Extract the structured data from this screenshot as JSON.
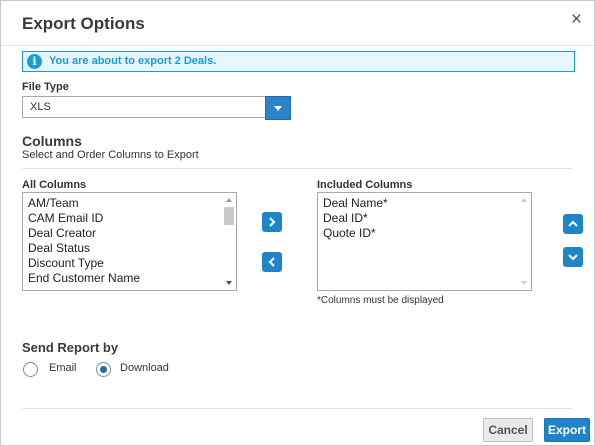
{
  "dialog": {
    "title": "Export Options",
    "close_symbol": "×"
  },
  "info": {
    "icon_glyph": "i",
    "message": "You are about to export 2 Deals."
  },
  "file_type": {
    "label": "File Type",
    "value": "XLS"
  },
  "columns": {
    "title": "Columns",
    "subtitle": "Select and Order Columns to Export",
    "all_label": "All Columns",
    "all_items": [
      "AM/Team",
      "CAM Email ID",
      "Deal Creator",
      "Deal Status",
      "Discount Type",
      "End Customer Name"
    ],
    "included_label": "Included Columns",
    "included_items": [
      "Deal Name*",
      "Deal ID*",
      "Quote ID*"
    ],
    "note": "*Columns must be displayed"
  },
  "send": {
    "title": "Send Report by",
    "options": [
      {
        "label": "Email",
        "checked": false
      },
      {
        "label": "Download",
        "checked": true
      }
    ]
  },
  "footer": {
    "cancel_label": "Cancel",
    "export_label": "Export"
  },
  "colors": {
    "accent": "#1f85c8",
    "info_border": "#1a9ad6",
    "info_bg": "#e8f6fc"
  }
}
